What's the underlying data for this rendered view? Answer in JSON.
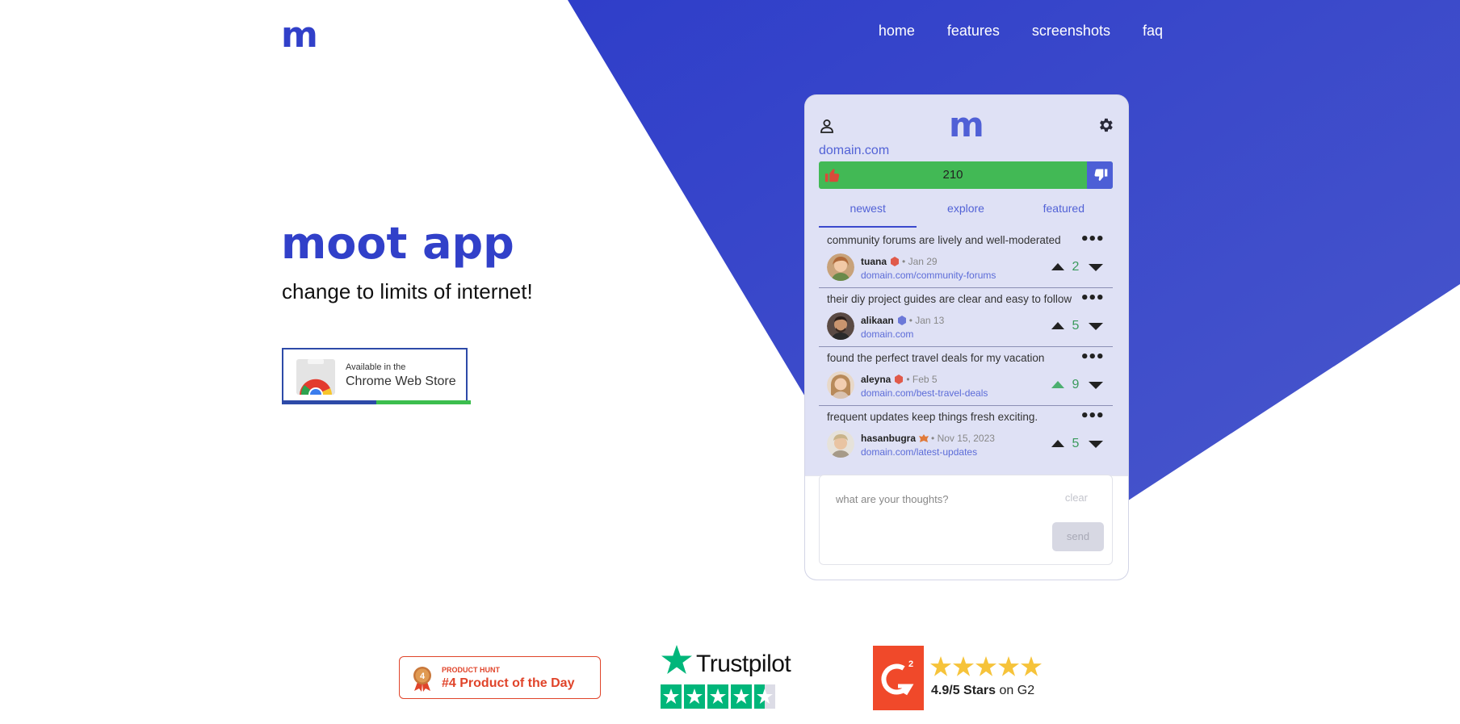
{
  "brand": {
    "logo": "m"
  },
  "nav": {
    "items": [
      "home",
      "features",
      "screenshots",
      "faq"
    ]
  },
  "hero": {
    "title": "moot app",
    "subtitle": "change to limits of internet!",
    "store_badge": {
      "line1": "Available in the",
      "line2": "Chrome Web Store"
    }
  },
  "panel": {
    "logo": "m",
    "domain": "domain.com",
    "vote_count": "210",
    "tabs": [
      {
        "label": "newest",
        "active": true
      },
      {
        "label": "explore",
        "active": false
      },
      {
        "label": "featured",
        "active": false
      }
    ],
    "posts": [
      {
        "text": "community forums are lively and well-moderated",
        "user": "tuana",
        "date": "Jan 29",
        "link": "domain.com/community-forums",
        "score": "2",
        "badge_color": "#e05a4a",
        "upvoted": false
      },
      {
        "text": "their diy project guides are clear and easy to follow",
        "user": "alikaan",
        "date": "Jan 13",
        "link": "domain.com",
        "score": "5",
        "badge_color": "#6b78d8",
        "upvoted": false
      },
      {
        "text": "found the perfect travel deals for my vacation",
        "user": "aleyna",
        "date": "Feb 5",
        "link": "domain.com/best-travel-deals",
        "score": "9",
        "badge_color": "#e05a4a",
        "upvoted": true
      },
      {
        "text": "frequent updates keep things fresh exciting.",
        "user": "hasanbugra",
        "date": "Nov 15, 2023",
        "link": "domain.com/latest-updates",
        "score": "5",
        "badge_color": "#e07a3a",
        "upvoted": false
      }
    ],
    "composer": {
      "placeholder": "what are your thoughts?",
      "clear": "clear",
      "send": "send"
    }
  },
  "awards": {
    "product_hunt": {
      "rank": "4",
      "label_small": "PRODUCT HUNT",
      "label_big": "#4 Product of the Day"
    },
    "trustpilot": {
      "name": "Trustpilot",
      "stars": 4.5
    },
    "g2": {
      "rating_bold": "4.9/5 Stars",
      "rating_rest": " on G2",
      "stars": 5
    }
  },
  "colors": {
    "accent": "#3140c9",
    "green": "#42b955",
    "orange": "#e0442a"
  }
}
